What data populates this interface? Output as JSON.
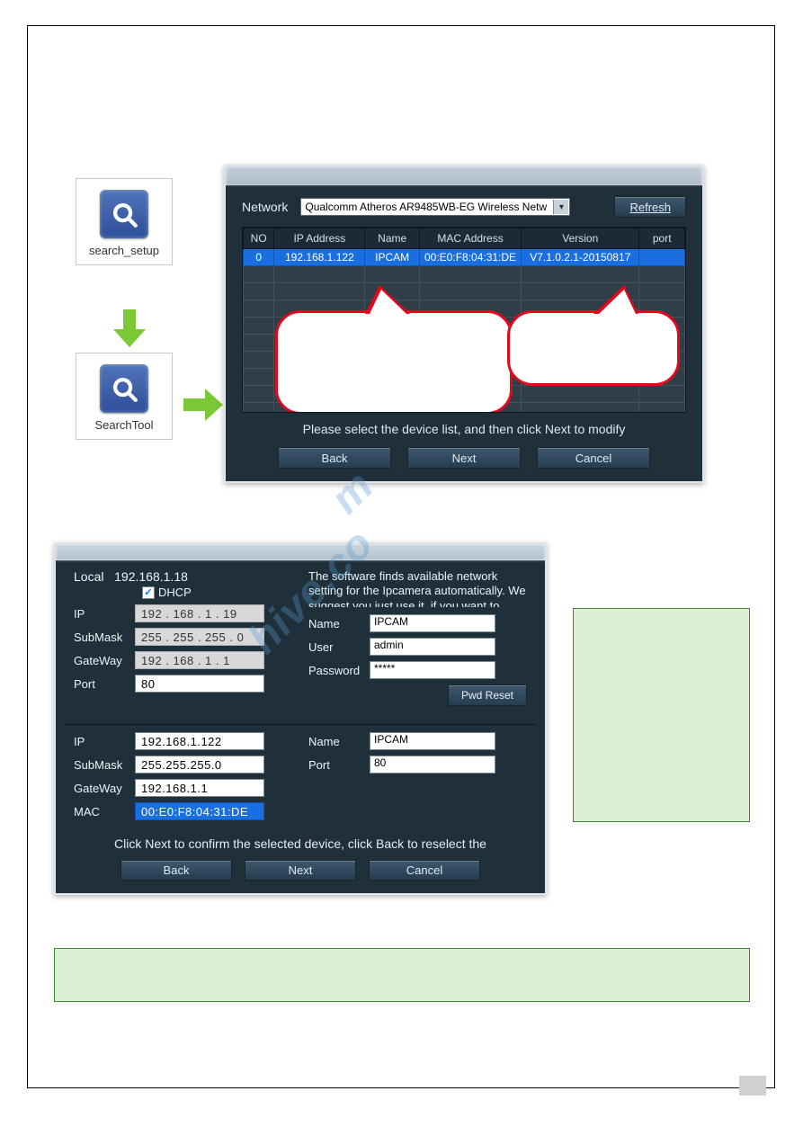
{
  "icons": {
    "search_setup_label": "search_setup",
    "search_tool_label": "SearchTool"
  },
  "dialog1": {
    "network_label": "Network",
    "network_selected": "Qualcomm Atheros AR9485WB-EG Wireless Netw",
    "refresh_label": "Refresh",
    "headers": {
      "no": "NO",
      "ip": "IP Address",
      "name": "Name",
      "mac": "MAC Address",
      "version": "Version",
      "port": "port"
    },
    "row": {
      "no": "0",
      "ip": "192.168.1.122",
      "name": "IPCAM",
      "mac": "00:E0:F8:04:31:DE",
      "version": "V7.1.0.2.1-20150817",
      "port": ""
    },
    "instruction": "Please select the device list, and then click Next to modify",
    "back": "Back",
    "next": "Next",
    "cancel": "Cancel"
  },
  "dialog2": {
    "local_label": "Local",
    "local_ip": "192.168.1.18",
    "dhcp_label": "DHCP",
    "info_text": "The software finds available network setting for the Ipcamera automatically. We suggest you just use it, if you want to modify it manually.",
    "left_labels": {
      "ip": "IP",
      "submask": "SubMask",
      "gateway": "GateWay",
      "port": "Port"
    },
    "left_values": {
      "ip": "192 . 168 .  1  .  19",
      "submask": "255 . 255 . 255 .  0",
      "gateway": "192 . 168 .  1  .  1",
      "port": "80"
    },
    "right_labels": {
      "name": "Name",
      "user": "User",
      "password": "Password"
    },
    "right_values": {
      "name": "IPCAM",
      "user": "admin",
      "password": "*****"
    },
    "pwd_reset": "Pwd Reset",
    "bottom_left_labels": {
      "ip": "IP",
      "submask": "SubMask",
      "gateway": "GateWay",
      "mac": "MAC"
    },
    "bottom_left_values": {
      "ip": "192.168.1.122",
      "submask": "255.255.255.0",
      "gateway": "192.168.1.1",
      "mac": "00:E0:F8:04:31:DE"
    },
    "bottom_right_labels": {
      "name": "Name",
      "port": "Port"
    },
    "bottom_right_values": {
      "name": "IPCAM",
      "port": "80"
    },
    "instruction": "Click Next to confirm the selected device, click Back to reselect the",
    "back": "Back",
    "next": "Next",
    "cancel": "Cancel"
  }
}
